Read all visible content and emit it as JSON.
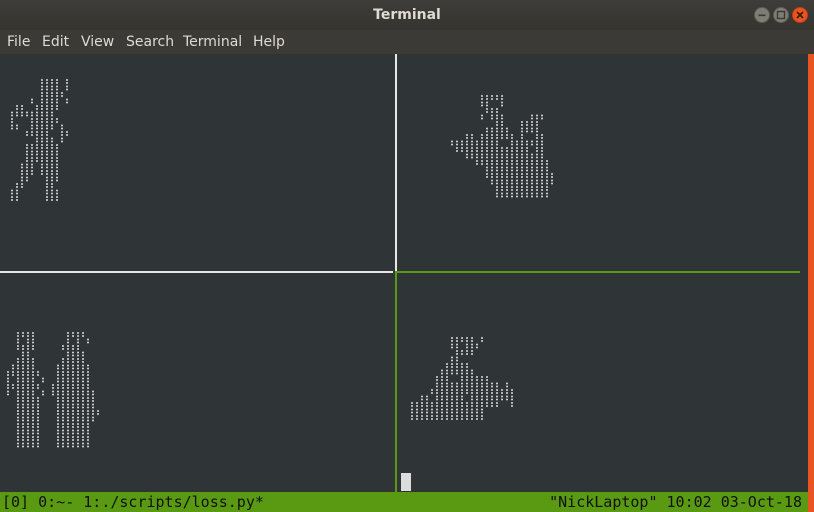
{
  "window": {
    "title": "Terminal"
  },
  "menubar": {
    "items": [
      "File",
      "Edit",
      "View",
      "Search",
      "Terminal",
      "Help"
    ]
  },
  "tmux": {
    "status_left": "[0] 0:~- 1:./scripts/loss.py*",
    "status_right": "\"NickLaptop\" 10:02 03-Oct-18"
  },
  "colors": {
    "accent": "#e95420",
    "active_pane_border": "#5a9a13",
    "terminal_bg": "#2f3436",
    "status_bar": "#5a9a13"
  },
  "icons": {
    "minimize": "minimize-icon",
    "maximize": "maximize-icon",
    "close": "close-icon"
  }
}
